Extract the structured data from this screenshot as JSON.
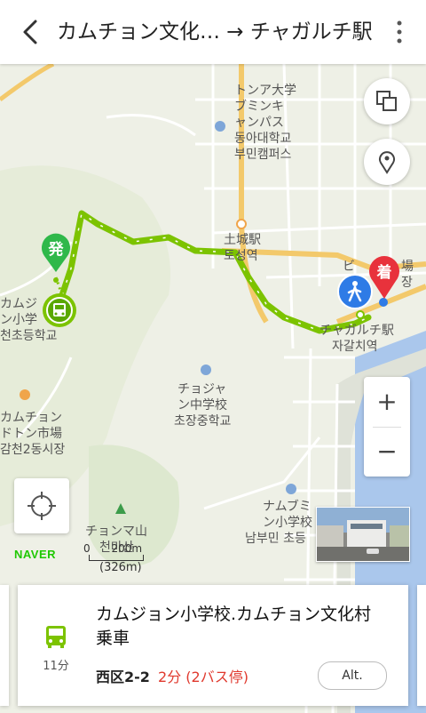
{
  "header": {
    "route_title": "カムチョン文化… → チャガルチ駅",
    "back_icon": "chevron-left-icon",
    "menu_icon": "kebab-menu-icon"
  },
  "map": {
    "labels": {
      "univ_jp_1": "トンア大学",
      "univ_jp_2": "ブミンキ",
      "univ_jp_3": "ャンパス",
      "univ_kr_1": "동아대학교",
      "univ_kr_2": "부민캠퍼스",
      "toseong_jp": "土城駅",
      "toseong_kr": "토성역",
      "jagalchi_jp": "チャガルチ駅",
      "jagalchi_kr": "자갈치역",
      "school_left_1": "カムジ",
      "school_left_2": "ン小学",
      "school_left_3": "천초등학교",
      "market_1": "カムチョン",
      "market_2": "ドトン市場",
      "market_3": "감천2동시장",
      "chojang_1": "チョジャ",
      "chojang_2": "ン中学校",
      "chojang_3": "초장중학교",
      "chonma_1": "チョンマ山",
      "chonma_2": "천마산",
      "namubumin_1": "ナムブミ",
      "namubumin_2": "ン小学校",
      "namubumin_3": "남부민 초등",
      "bi_1": "ビ",
      "bi_2": "場",
      "bi_3": "장"
    },
    "start_marker": "発",
    "end_marker": "着",
    "naver_logo": "NAVER",
    "scale_text_1": "0",
    "scale_text_2": "200m",
    "scale_text_3": "(326m)",
    "route_color": "#7cc300",
    "start_color": "#2fb84a",
    "end_color": "#e8323c",
    "walk_color": "#2e7be6"
  },
  "controls": {
    "layers_icon": "layers-icon",
    "location_pin_icon": "location-pin-icon",
    "zoom_in": "+",
    "zoom_out": "−",
    "locate_icon": "crosshair-icon"
  },
  "card": {
    "bus_icon": "bus-icon",
    "minutes": "11分",
    "stop_name": "カムジョン小学校.カムチョン文化村乗車",
    "line": "西区2-2",
    "wait": "2分 (2バス停)",
    "alt_label": "Alt."
  }
}
